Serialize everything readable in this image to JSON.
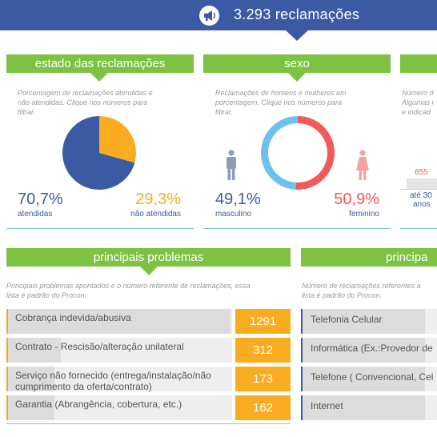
{
  "header": {
    "title": "3.293 reclamações"
  },
  "estado": {
    "title": "estado das reclamações",
    "description": "Porcentagem de reclamações atendidas e\nnão atendidas. Clique nos números para\nfiltrar.",
    "atendidas": {
      "pct_label": "70,7%",
      "label": "atendidas",
      "value": 70.7,
      "color": "#3b5aa3"
    },
    "nao_atendidas": {
      "pct_label": "29,3%",
      "label": "não atendidas",
      "value": 29.3,
      "color": "#f9ac1f"
    }
  },
  "sexo": {
    "title": "sexo",
    "description": "Reclamações de homens e mulheres em\nporcentagem. Clique nos números para\nfiltrar.",
    "masculino": {
      "pct_label": "49,1%",
      "label": "masculino",
      "value": 49.1,
      "color": "#6ec1ec"
    },
    "feminino": {
      "pct_label": "50,9%",
      "label": "feminino",
      "value": 50.9,
      "color": "#f15a5a"
    }
  },
  "idade": {
    "description": "Número d\nAlgumas r\ne indicad",
    "bar_value": "655",
    "bar_label_1": "até 30",
    "bar_label_2": "anos"
  },
  "problemas": {
    "title": "principais problemas",
    "description": "Principais problemas apontados e o número referente de reclamações, essa\nlista é padrão do Procon.",
    "items": [
      {
        "label": "Cobrança indevida/abusiva",
        "count": "1291",
        "value": 1291
      },
      {
        "label": "Contrato - Rescisão/alteração unilateral",
        "count": "312",
        "value": 312
      },
      {
        "label": "Serviço não fornecido (entrega/instalação/não cumprimento da oferta/contrato)",
        "count": "173",
        "value": 173
      },
      {
        "label": "Garantia (Abrangência, cobertura, etc.)",
        "count": "162",
        "value": 162
      }
    ]
  },
  "categorias": {
    "title": "principa",
    "description": "Número de reclamações referentes a\nlista é padrão do Procon.",
    "items": [
      {
        "label": "Telefonia Celular"
      },
      {
        "label": "Informática (Ex.:Provedor de"
      },
      {
        "label": "Telefone ( Convencional, Cel"
      },
      {
        "label": "Internet"
      }
    ]
  }
}
